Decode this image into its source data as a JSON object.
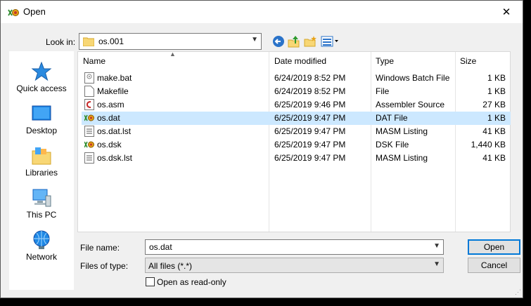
{
  "window": {
    "title": "Open",
    "close_glyph": "✕"
  },
  "lookin": {
    "label": "Look in:",
    "value": "os.001"
  },
  "places": [
    {
      "label": "Quick access",
      "icon": "star-icon"
    },
    {
      "label": "Desktop",
      "icon": "desktop-icon"
    },
    {
      "label": "Libraries",
      "icon": "libraries-icon"
    },
    {
      "label": "This PC",
      "icon": "computer-icon"
    },
    {
      "label": "Network",
      "icon": "network-icon"
    }
  ],
  "columns": {
    "name": "Name",
    "date": "Date modified",
    "type": "Type",
    "size": "Size"
  },
  "files": [
    {
      "name": "make.bat",
      "date": "6/24/2019 8:52 PM",
      "type": "Windows Batch File",
      "size": "1 KB",
      "icon": "batch-file-icon"
    },
    {
      "name": "Makefile",
      "date": "6/24/2019 8:52 PM",
      "type": "File",
      "size": "1 KB",
      "icon": "blank-file-icon"
    },
    {
      "name": "os.asm",
      "date": "6/25/2019 9:46 PM",
      "type": "Assembler Source",
      "size": "27 KB",
      "icon": "asm-file-icon"
    },
    {
      "name": "os.dat",
      "date": "6/25/2019 9:47 PM",
      "type": "DAT File",
      "size": "1 KB",
      "icon": "dat-file-icon"
    },
    {
      "name": "os.dat.lst",
      "date": "6/25/2019 9:47 PM",
      "type": "MASM Listing",
      "size": "41 KB",
      "icon": "listing-file-icon"
    },
    {
      "name": "os.dsk",
      "date": "6/25/2019 9:47 PM",
      "type": "DSK File",
      "size": "1,440 KB",
      "icon": "dsk-file-icon"
    },
    {
      "name": "os.dsk.lst",
      "date": "6/25/2019 9:47 PM",
      "type": "MASM Listing",
      "size": "41 KB",
      "icon": "listing-file-icon"
    }
  ],
  "selected_file": "os.dat",
  "filename": {
    "label": "File name:",
    "value": "os.dat"
  },
  "filetype": {
    "label": "Files of type:",
    "value": "All files (*.*)"
  },
  "readonly": {
    "label": "Open as read-only",
    "checked": false
  },
  "buttons": {
    "open": "Open",
    "cancel": "Cancel"
  },
  "colors": {
    "selection": "#cce8ff",
    "accent": "#0078d7"
  }
}
